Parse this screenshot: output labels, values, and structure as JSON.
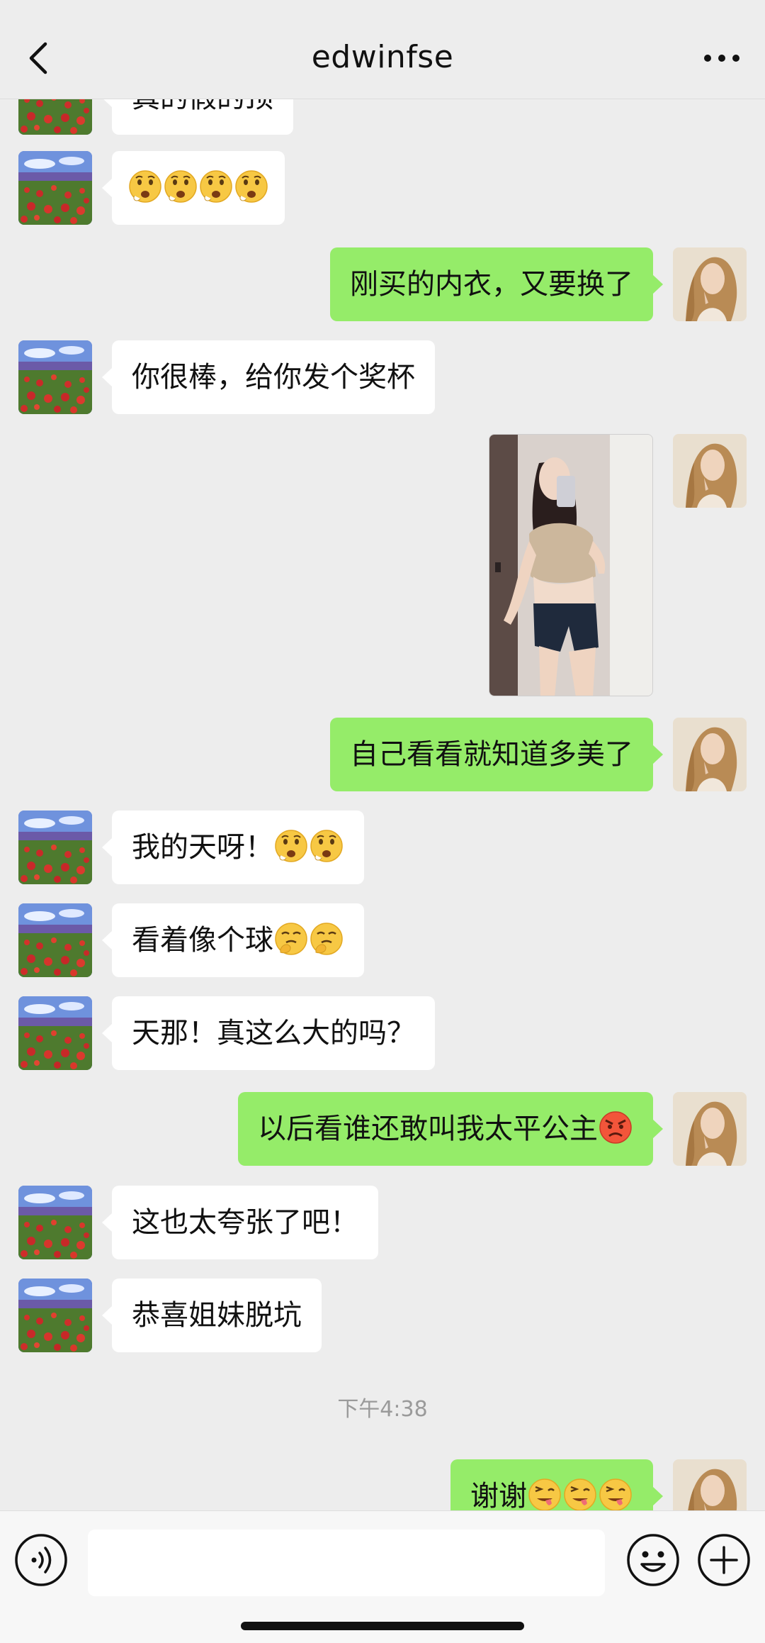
{
  "header": {
    "title": "edwinfse"
  },
  "messages": [
    {
      "id": "m0",
      "side": "in",
      "text": "真的假的顶",
      "emoji_count": 0
    },
    {
      "id": "m1",
      "side": "in",
      "text": "",
      "emoji": "surprised-face-emoji",
      "emoji_count": 4
    },
    {
      "id": "m2",
      "side": "out",
      "text": "刚买的内衣，又要换了"
    },
    {
      "id": "m3",
      "side": "in",
      "text": "你很棒，给你发个奖杯"
    },
    {
      "id": "m4",
      "side": "out",
      "type": "image"
    },
    {
      "id": "m5",
      "side": "out",
      "text": "自己看看就知道多美了"
    },
    {
      "id": "m6",
      "side": "in",
      "text": "我的天呀！",
      "emoji": "surprised-face-emoji",
      "emoji_count": 2
    },
    {
      "id": "m7",
      "side": "in",
      "text": "看着像个球",
      "emoji": "thinking-face-emoji",
      "emoji_count": 2
    },
    {
      "id": "m8",
      "side": "in",
      "text": "天那！真这么大的吗？"
    },
    {
      "id": "m9",
      "side": "out",
      "text": "以后看谁还敢叫我太平公主",
      "emoji": "angry-face-emoji",
      "emoji_count": 1
    },
    {
      "id": "m10",
      "side": "in",
      "text": "这也太夸张了吧！"
    },
    {
      "id": "m11",
      "side": "in",
      "text": "恭喜姐妹脱坑"
    },
    {
      "id": "m12",
      "side": "out",
      "text": "谢谢",
      "emoji": "winking-tongue-emoji",
      "emoji_count": 3
    }
  ],
  "timestamp": "下午4:38",
  "input": {
    "placeholder": ""
  },
  "colors": {
    "background": "#ededed",
    "outgoing_bubble": "#95ec69",
    "incoming_bubble": "#ffffff"
  },
  "icons": [
    "back-arrow-icon",
    "more-dots-icon",
    "voice-icon",
    "emoji-icon",
    "plus-icon"
  ]
}
